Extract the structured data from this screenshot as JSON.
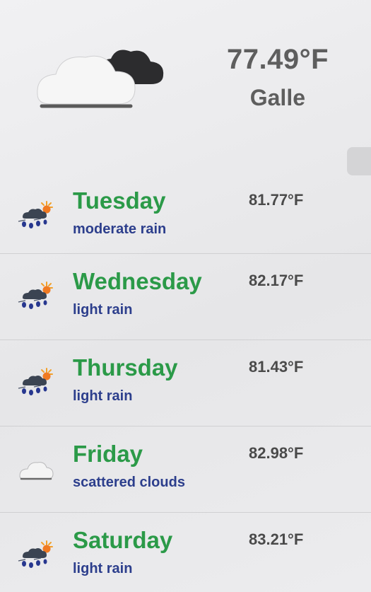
{
  "current": {
    "temperature": "77.49°F",
    "city": "Galle",
    "icon": "broken-clouds-icon"
  },
  "forecast": [
    {
      "day": "Tuesday",
      "condition": "moderate rain",
      "temperature": "81.77°F",
      "icon": "rain-sun-icon"
    },
    {
      "day": "Wednesday",
      "condition": "light rain",
      "temperature": "82.17°F",
      "icon": "rain-sun-icon"
    },
    {
      "day": "Thursday",
      "condition": "light rain",
      "temperature": "81.43°F",
      "icon": "rain-sun-icon"
    },
    {
      "day": "Friday",
      "condition": "scattered clouds",
      "temperature": "82.98°F",
      "icon": "cloud-icon"
    },
    {
      "day": "Saturday",
      "condition": "light rain",
      "temperature": "83.21°F",
      "icon": "rain-sun-icon"
    }
  ],
  "colors": {
    "day_name": "#2b9a48",
    "condition": "#2c3e8c",
    "temperature": "#4a4a4a",
    "header_text": "#5e5e5e"
  }
}
